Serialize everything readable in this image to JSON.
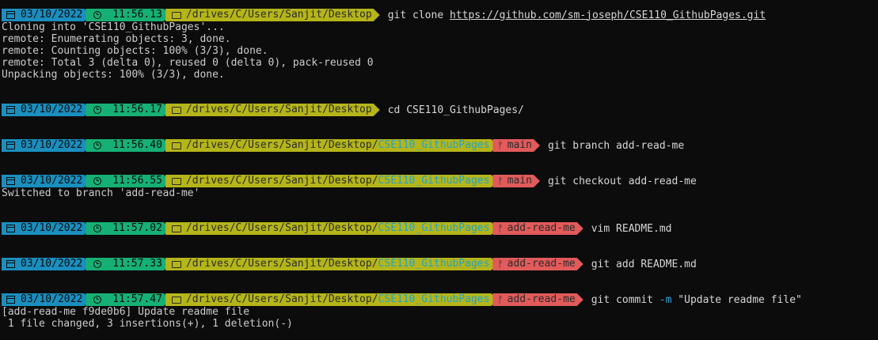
{
  "prompts": [
    {
      "date": "03/10/2022",
      "time": "11:56.13",
      "path_base": "/drives/C/Users/Sanjit/Desktop",
      "path_repo": "",
      "branch": "",
      "cmd": "git clone ",
      "cmd_url": "https://github.com/sm-joseph/CSE110_GithubPages.git"
    },
    {
      "date": "03/10/2022",
      "time": "11:56.17",
      "path_base": "/drives/C/Users/Sanjit/Desktop",
      "path_repo": "",
      "branch": "",
      "cmd": "cd CSE110_GithubPages/"
    },
    {
      "date": "03/10/2022",
      "time": "11:56.40",
      "path_base": "/drives/C/Users/Sanjit/Desktop/",
      "path_repo": "CSE110_GithubPages",
      "branch": "main",
      "cmd": "git branch add-read-me"
    },
    {
      "date": "03/10/2022",
      "time": "11:56.55",
      "path_base": "/drives/C/Users/Sanjit/Desktop/",
      "path_repo": "CSE110_GithubPages",
      "branch": "main",
      "cmd": "git checkout add-read-me"
    },
    {
      "date": "03/10/2022",
      "time": "11:57.02",
      "path_base": "/drives/C/Users/Sanjit/Desktop/",
      "path_repo": "CSE110_GithubPages",
      "branch": "add-read-me",
      "cmd": "vim README.md"
    },
    {
      "date": "03/10/2022",
      "time": "11:57.33",
      "path_base": "/drives/C/Users/Sanjit/Desktop/",
      "path_repo": "CSE110_GithubPages",
      "branch": "add-read-me",
      "cmd": "git add README.md"
    },
    {
      "date": "03/10/2022",
      "time": "11:57.47",
      "path_base": "/drives/C/Users/Sanjit/Desktop/",
      "path_repo": "CSE110_GithubPages",
      "branch": "add-read-me",
      "cmd": "git commit ",
      "cmd_flag": "-m",
      "cmd_rest": " \"Update readme file\""
    }
  ],
  "output": {
    "clone": [
      "Cloning into 'CSE110_GithubPages'...",
      "remote: Enumerating objects: 3, done.",
      "remote: Counting objects: 100% (3/3), done.",
      "remote: Total 3 (delta 0), reused 0 (delta 0), pack-reused 0",
      "Unpacking objects: 100% (3/3), done."
    ],
    "checkout": [
      "Switched to branch 'add-read-me'"
    ],
    "commit": [
      "[add-read-me f9de0b6] Update readme file",
      " 1 file changed, 3 insertions(+), 1 deletion(-)"
    ]
  },
  "icons": {
    "calendar": "calendar-icon",
    "clock": "clock-icon",
    "folder": "folder-icon",
    "branch": "git-branch-icon"
  },
  "colors": {
    "date_segment": "#1a8fbf",
    "time_segment": "#16b074",
    "path_segment": "#b5b51a",
    "branch_segment": "#e25a5a",
    "repo_highlight": "#1fa3c8",
    "background": "#0c0c0c",
    "text": "#cccccc"
  }
}
